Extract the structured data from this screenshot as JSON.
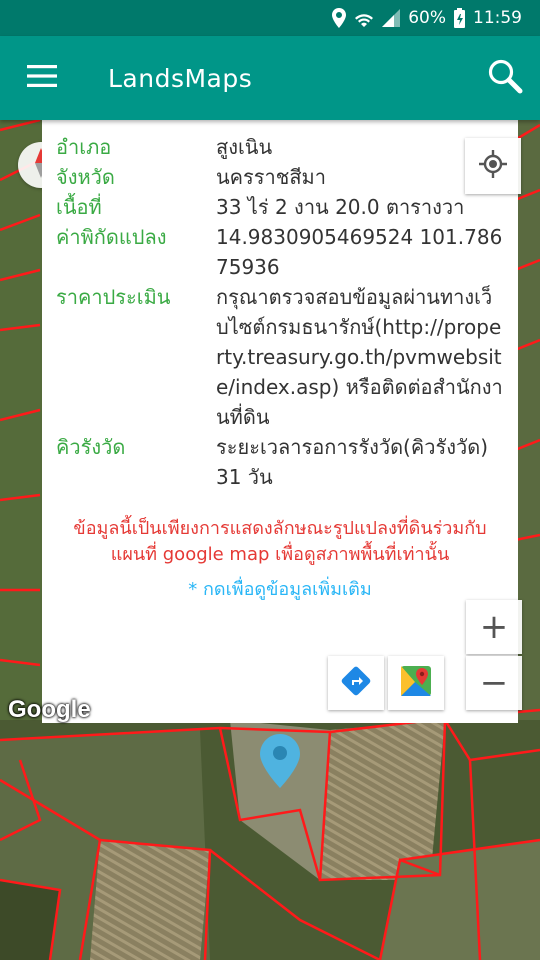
{
  "status_bar": {
    "battery": "60%",
    "time": "11:59"
  },
  "app_bar": {
    "title": "LandsMaps"
  },
  "details": [
    {
      "key": "อำเภอ",
      "value": "สูงเนิน"
    },
    {
      "key": "จังหวัด",
      "value": "นครราชสีมา"
    },
    {
      "key": "เนื้อที่",
      "value": "33 ไร่ 2 งาน 20.0 ตารางวา"
    },
    {
      "key": "ค่าพิกัดแปลง",
      "value": "14.9830905469524 101.78675936"
    },
    {
      "key": "ราคาประเมิน",
      "value": "กรุณาตรวจสอบข้อมูลผ่านทางเว็บไซต์กรมธนารักษ์(http://property.treasury.go.th/pvmwebsite/index.asp) หรือติดต่อสำนักงานที่ดิน"
    },
    {
      "key": "คิวรังวัด",
      "value": "ระยะเวลารอการรังวัด(คิวรังวัด) 31 วัน"
    }
  ],
  "disclaimer": "ข้อมูลนี้เป็นเพียงการแสดงลักษณะรูปแปลงที่ดินร่วมกับแผนที่ google map เพื่อดูสภาพพื้นที่เท่านั้น",
  "more_link": "* กดเพื่อดูข้อมูลเพิ่มเติม",
  "map": {
    "attribution": "Google",
    "zoom_in": "+",
    "zoom_out": "−"
  },
  "colors": {
    "accent": "#009688",
    "status_bar": "#00796b",
    "label": "#3aaa44",
    "warning": "#e53935",
    "link": "#29b6f6",
    "parcel_line": "#ff1a1a"
  }
}
